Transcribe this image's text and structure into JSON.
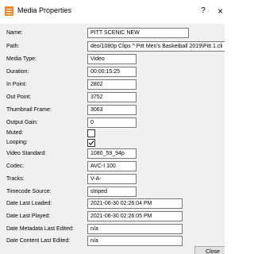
{
  "window": {
    "title": "Media Properties",
    "help_glyph": "?",
    "close_glyph": "×",
    "icon": "media-properties-icon"
  },
  "fields": {
    "name": {
      "label": "Name:",
      "value": "PITT SCENIC  NEW"
    },
    "path": {
      "label": "Path:",
      "value": "deo/1080p Clips ^ Pitt Men's Basketball 2019\\Pitt 1.cli"
    },
    "media_type": {
      "label": "Media Type:",
      "value": "Video"
    },
    "duration": {
      "label": "Duration:",
      "value": "00:00:15:25"
    },
    "in_point": {
      "label": "In Point:",
      "value": "2802"
    },
    "out_point": {
      "label": "Out Point:",
      "value": "3752"
    },
    "thumbnail_frame": {
      "label": "Thumbnail Frame:",
      "value": "3063"
    },
    "output_gain": {
      "label": "Output Gain:",
      "value": "0"
    },
    "muted": {
      "label": "Muted:",
      "checked": false
    },
    "looping": {
      "label": "Looping:",
      "checked": true
    },
    "video_standard": {
      "label": "Video Standard:",
      "value": "1080_59_94p"
    },
    "codec": {
      "label": "Codec:",
      "value": "AVC-I 100"
    },
    "tracks": {
      "label": "Tracks:",
      "value": "V-A-"
    },
    "timecode_source": {
      "label": "Timecode Source:",
      "value": "striped"
    },
    "date_last_loaded": {
      "label": "Date Last Loaded:",
      "value": "2021-06-30 02:26:04 PM"
    },
    "date_last_played": {
      "label": "Date Last Played:",
      "value": "2021-06-30 02:26:05 PM"
    },
    "date_metadata_last_edited": {
      "label": "Date Metadata Last Edited:",
      "value": "n/a"
    },
    "date_content_last_edited": {
      "label": "Date Content Last Edited:",
      "value": "n/a"
    }
  },
  "buttons": {
    "close_label": "Close"
  },
  "colors": {
    "accent_icon": "#f0872a",
    "dialog_bg": "#f0f0f0",
    "field_border": "#7a7a7a"
  }
}
